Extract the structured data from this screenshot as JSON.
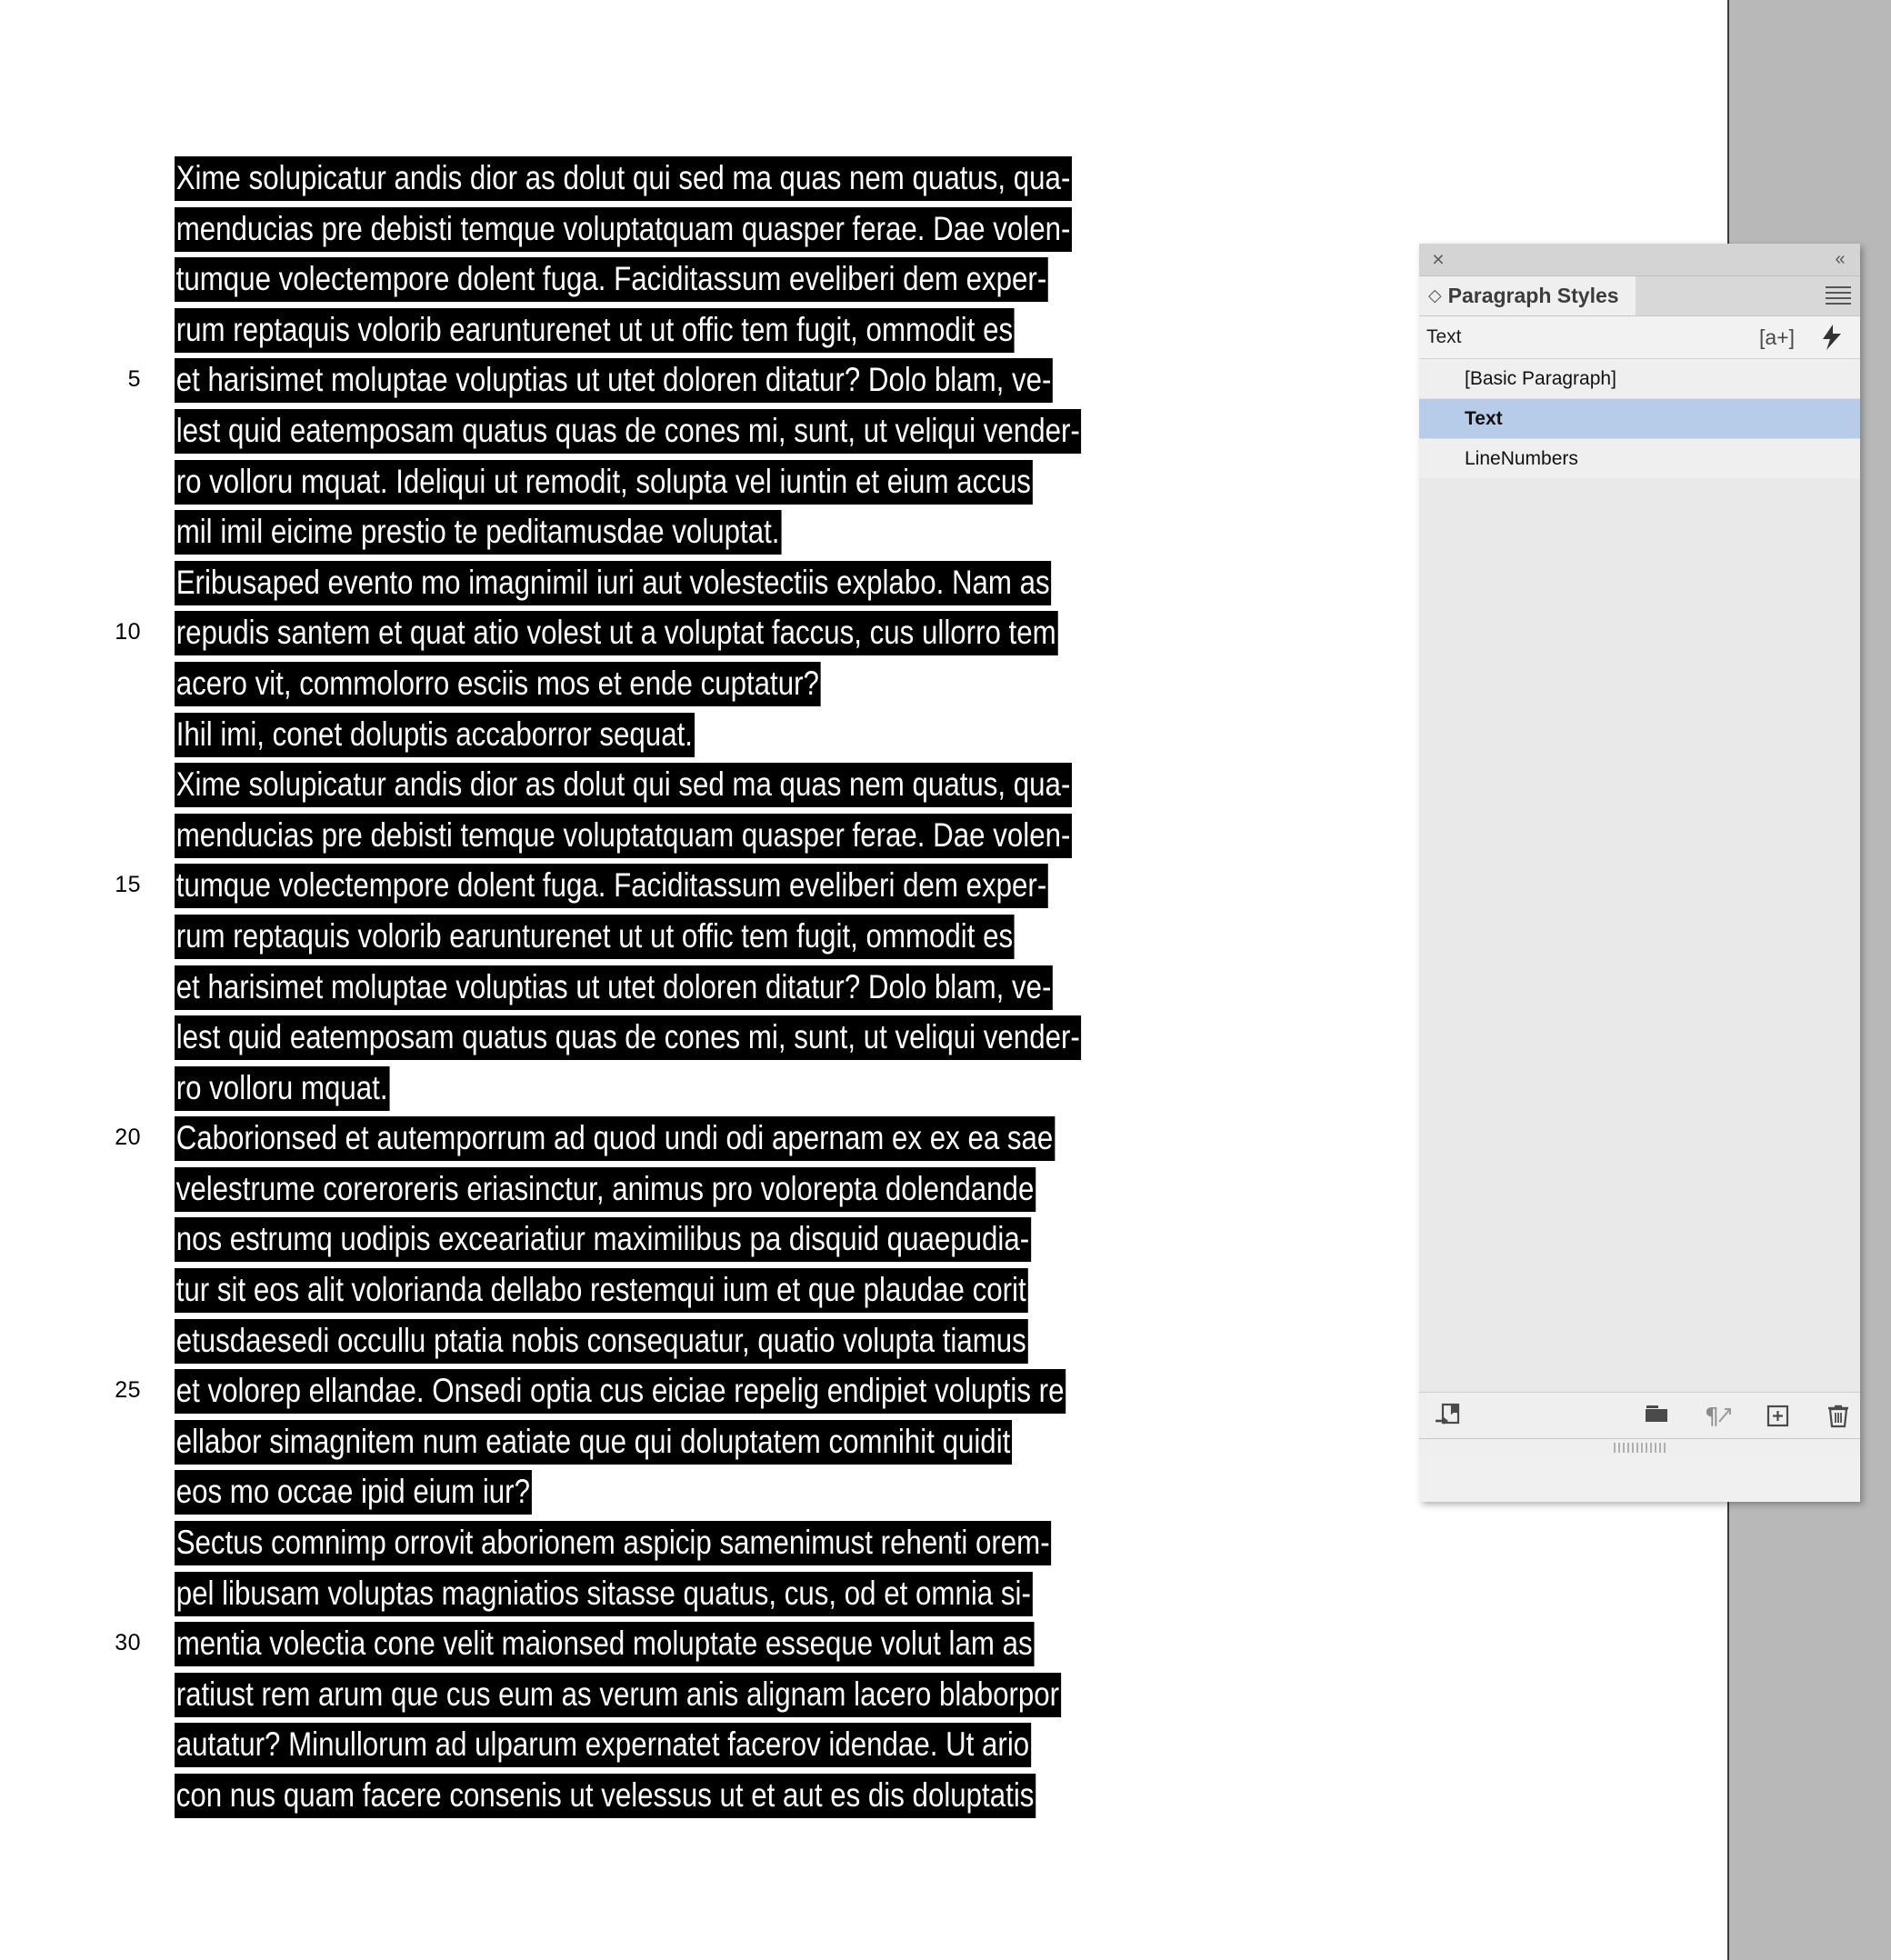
{
  "document": {
    "line_numbers_visible": [
      5,
      10,
      15,
      20,
      25,
      30
    ],
    "lines": [
      {
        "n": 1,
        "num": "",
        "text": "Xime solupicatur andis dior as dolut qui sed ma quas nem quatus, qua-"
      },
      {
        "n": 2,
        "num": "",
        "text": "menducias pre debisti temque voluptatquam quasper ferae. Dae volen-"
      },
      {
        "n": 3,
        "num": "",
        "text": "tumque volectempore dolent fuga. Faciditassum eveliberi dem exper-"
      },
      {
        "n": 4,
        "num": "",
        "text": "rum reptaquis volorib earunturenet ut ut offic tem fugit, ommodit es"
      },
      {
        "n": 5,
        "num": "5",
        "text": "et harisimet moluptae voluptias ut utet doloren ditatur? Dolo blam, ve-"
      },
      {
        "n": 6,
        "num": "",
        "text": "lest quid eatemposam quatus quas de cones mi, sunt, ut veliqui vender-"
      },
      {
        "n": 7,
        "num": "",
        "text": "ro volloru mquat. Ideliqui ut remodit, solupta vel iuntin et eium accus"
      },
      {
        "n": 8,
        "num": "",
        "text": "mil imil eicime prestio te peditamusdae voluptat."
      },
      {
        "n": 9,
        "num": "",
        "text": "Eribusaped evento mo imagnimil iuri aut volestectiis explabo. Nam as"
      },
      {
        "n": 10,
        "num": "10",
        "text": "repudis santem et quat atio volest ut a voluptat faccus, cus ullorro tem"
      },
      {
        "n": 11,
        "num": "",
        "text": "acero vit, commolorro esciis mos et ende cuptatur?"
      },
      {
        "n": 12,
        "num": "",
        "text": "Ihil imi, conet doluptis accaborror sequat."
      },
      {
        "n": 13,
        "num": "",
        "text": "Xime solupicatur andis dior as dolut qui sed ma quas nem quatus, qua-"
      },
      {
        "n": 14,
        "num": "",
        "text": "menducias pre debisti temque voluptatquam quasper ferae. Dae volen-"
      },
      {
        "n": 15,
        "num": "15",
        "text": "tumque volectempore dolent fuga. Faciditassum eveliberi dem exper-"
      },
      {
        "n": 16,
        "num": "",
        "text": "rum reptaquis volorib earunturenet ut ut offic tem fugit, ommodit es"
      },
      {
        "n": 17,
        "num": "",
        "text": "et harisimet moluptae voluptias ut utet doloren ditatur? Dolo blam, ve-"
      },
      {
        "n": 18,
        "num": "",
        "text": "lest quid eatemposam quatus quas de cones mi, sunt, ut veliqui vender-"
      },
      {
        "n": 19,
        "num": "",
        "text": "ro volloru mquat."
      },
      {
        "n": 20,
        "num": "20",
        "text": "Caborionsed et autemporrum ad quod undi odi apernam ex ex ea sae"
      },
      {
        "n": 21,
        "num": "",
        "text": "velestrume coreroreris eriasinctur, animus pro volorepta dolendande"
      },
      {
        "n": 22,
        "num": "",
        "text": "nos estrumq uodipis exceariatiur maximilibus pa disquid quaepudia-"
      },
      {
        "n": 23,
        "num": "",
        "text": "tur sit eos alit volorianda dellabo restemqui ium et que plaudae corit"
      },
      {
        "n": 24,
        "num": "",
        "text": "etusdaesedi occullu ptatia nobis consequatur, quatio volupta tiamus"
      },
      {
        "n": 25,
        "num": "25",
        "text": "et volorep ellandae. Onsedi optia cus eiciae repelig endipiet voluptis re"
      },
      {
        "n": 26,
        "num": "",
        "text": "ellabor simagnitem num eatiate que qui doluptatem comnihit quidit"
      },
      {
        "n": 27,
        "num": "",
        "text": "eos mo occae ipid eium iur?"
      },
      {
        "n": 28,
        "num": "",
        "text": "Sectus comnimp orrovit aborionem aspicip samenimust rehenti orem-"
      },
      {
        "n": 29,
        "num": "",
        "text": "pel libusam voluptas magniatios sitasse quatus, cus, od et omnia si-"
      },
      {
        "n": 30,
        "num": "30",
        "text": "mentia volectia cone velit maionsed moluptate esseque volut lam as"
      },
      {
        "n": 31,
        "num": "",
        "text": "ratiust rem arum que cus eum as verum anis alignam lacero blaborpor"
      },
      {
        "n": 32,
        "num": "",
        "text": "autatur? Minullorum ad ulparum expernatet facerov idendae. Ut ario"
      },
      {
        "n": 33,
        "num": "",
        "text": "con nus quam facere consenis ut velessus ut et aut es dis doluptatis"
      }
    ]
  },
  "panel": {
    "title": "Paragraph Styles",
    "close_icon": "×",
    "collapse_icon": "«",
    "menu_icon": "panel-menu-icon",
    "diamond_icon": "◇",
    "current_style": "Text",
    "apply_next_style_icon": "[a+]",
    "quick_apply_icon": "⚡",
    "styles": [
      {
        "label": "[Basic Paragraph]",
        "selected": false
      },
      {
        "label": "Text",
        "selected": true
      },
      {
        "label": "LineNumbers",
        "selected": false
      }
    ],
    "footer": {
      "load_styles": "load-styles-icon",
      "new_group": "new-style-group-icon",
      "clear_overrides": "clear-overrides-icon",
      "new_style": "new-style-icon",
      "delete_style": "delete-style-icon"
    }
  },
  "colors": {
    "selection_highlight": "#000000",
    "selection_text": "#ffffff",
    "panel_background": "#f0f0f0",
    "row_selected": "#b6cce8",
    "pasteboard": "#b8b8b8",
    "page": "#ffffff"
  }
}
